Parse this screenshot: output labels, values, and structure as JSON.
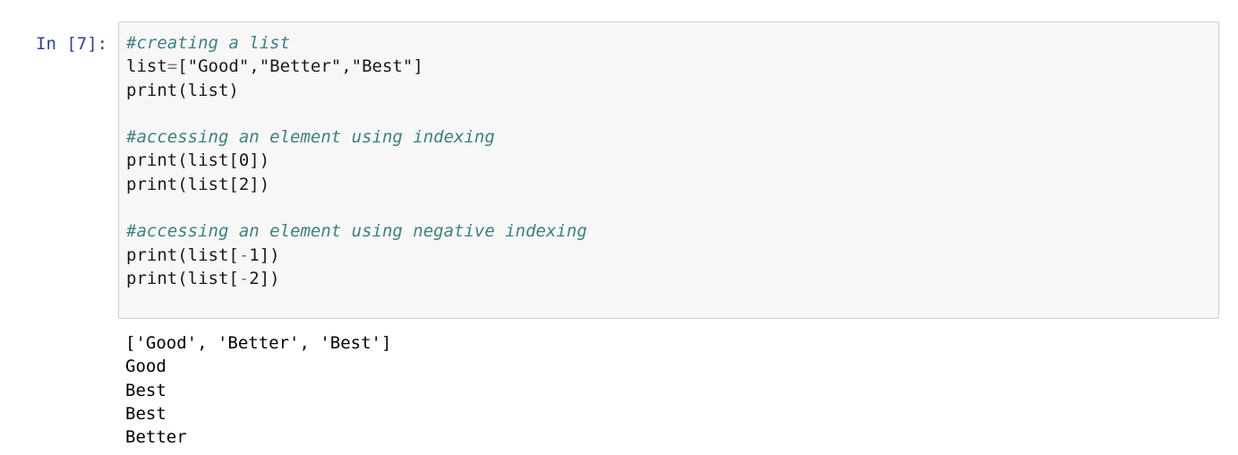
{
  "cell": {
    "prompt": "In [7]:",
    "code_lines": [
      {
        "type": "comment",
        "text": "#creating a list"
      },
      {
        "type": "code",
        "parts": [
          {
            "t": "plain",
            "text": "list"
          },
          {
            "t": "op",
            "text": "="
          },
          {
            "t": "plain",
            "text": "[\"Good\",\"Better\",\"Best\"]"
          }
        ]
      },
      {
        "type": "code",
        "parts": [
          {
            "t": "plain",
            "text": "print(list)"
          }
        ]
      },
      {
        "type": "blank"
      },
      {
        "type": "comment",
        "text": "#accessing an element using indexing"
      },
      {
        "type": "code",
        "parts": [
          {
            "t": "plain",
            "text": "print(list[0])"
          }
        ]
      },
      {
        "type": "code",
        "parts": [
          {
            "t": "plain",
            "text": "print(list[2])"
          }
        ]
      },
      {
        "type": "blank"
      },
      {
        "type": "comment",
        "text": "#accessing an element using negative indexing"
      },
      {
        "type": "code",
        "parts": [
          {
            "t": "plain",
            "text": "print(list["
          },
          {
            "t": "op",
            "text": "-"
          },
          {
            "t": "plain",
            "text": "1])"
          }
        ]
      },
      {
        "type": "code",
        "parts": [
          {
            "t": "plain",
            "text": "print(list["
          },
          {
            "t": "op",
            "text": "-"
          },
          {
            "t": "plain",
            "text": "2])"
          }
        ]
      }
    ],
    "output_lines": [
      "['Good', 'Better', 'Best']",
      "Good",
      "Best",
      "Best",
      "Better"
    ]
  },
  "colors": {
    "prompt": "#303f9f",
    "comment": "#408080",
    "operator": "#7a7a7a",
    "input_background": "#f7f7f7",
    "input_border": "#cfcfcf"
  }
}
